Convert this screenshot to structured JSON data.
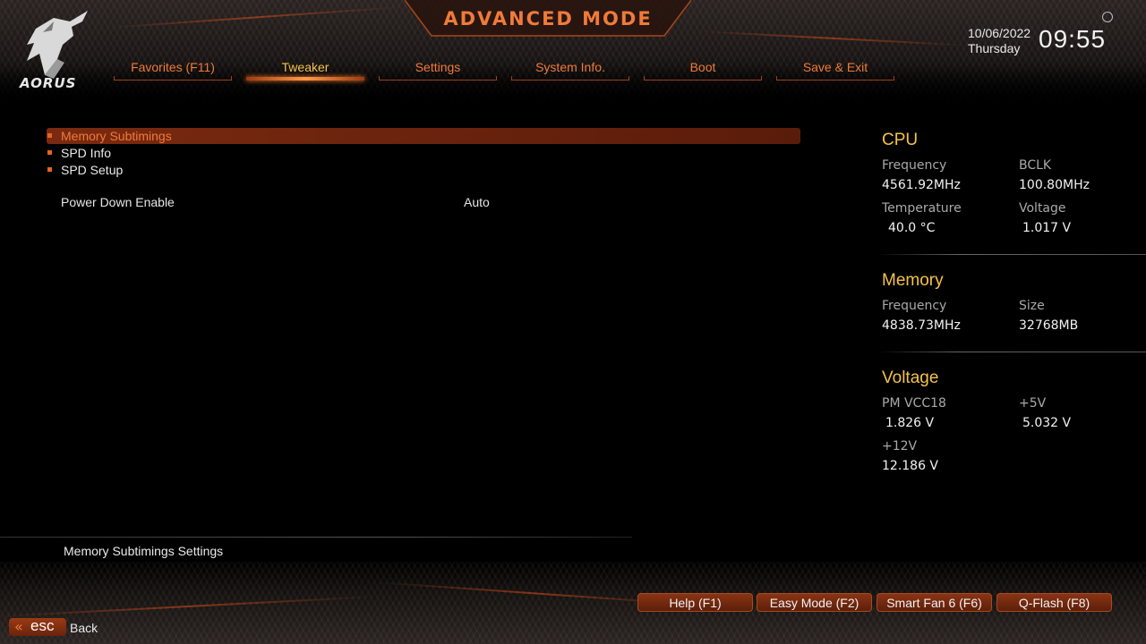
{
  "header": {
    "title": "ADVANCED MODE",
    "brand": "AORUS",
    "date": "10/06/2022",
    "day": "Thursday",
    "time": "09:55"
  },
  "tabs": [
    {
      "label": "Favorites (F11)",
      "active": false
    },
    {
      "label": "Tweaker",
      "active": true
    },
    {
      "label": "Settings",
      "active": false
    },
    {
      "label": "System Info.",
      "active": false
    },
    {
      "label": "Boot",
      "active": false
    },
    {
      "label": "Save & Exit",
      "active": false
    }
  ],
  "menu": {
    "items": [
      {
        "label": "Memory Subtimings",
        "selected": true
      },
      {
        "label": "SPD Info",
        "selected": false
      },
      {
        "label": "SPD Setup",
        "selected": false
      }
    ],
    "settings": [
      {
        "name": "Power Down Enable",
        "value": "Auto"
      }
    ]
  },
  "help_text": "Memory Subtimings Settings",
  "info_panel": {
    "cpu": {
      "title": "CPU",
      "frequency_label": "Frequency",
      "frequency": "4561.92MHz",
      "bclk_label": "BCLK",
      "bclk": "100.80MHz",
      "temperature_label": "Temperature",
      "temperature": "40.0 °C",
      "voltage_label": "Voltage",
      "voltage": "1.017 V"
    },
    "memory": {
      "title": "Memory",
      "frequency_label": "Frequency",
      "frequency": "4838.73MHz",
      "size_label": "Size",
      "size": "32768MB"
    },
    "voltage": {
      "title": "Voltage",
      "pmvcc18_label": "PM VCC18",
      "pmvcc18": "1.826 V",
      "plus5v_label": "+5V",
      "plus5v": "5.032 V",
      "plus12v_label": "+12V",
      "plus12v": "12.186 V"
    }
  },
  "footer": {
    "buttons": [
      {
        "label": "Help (F1)"
      },
      {
        "label": "Easy Mode (F2)"
      },
      {
        "label": "Smart Fan 6 (F6)"
      },
      {
        "label": "Q-Flash (F8)"
      }
    ],
    "esc_label": "esc",
    "back_label": "Back"
  },
  "colors": {
    "accent_orange": "#f07a3a",
    "accent_gold": "#f5c24a",
    "selection_bg": "#7a2a10",
    "background": "#000000"
  },
  "icons": {
    "logo": "aorus-eagle-icon",
    "settings": "gear-icon",
    "esc_chevron": "double-chevron-left-icon"
  }
}
